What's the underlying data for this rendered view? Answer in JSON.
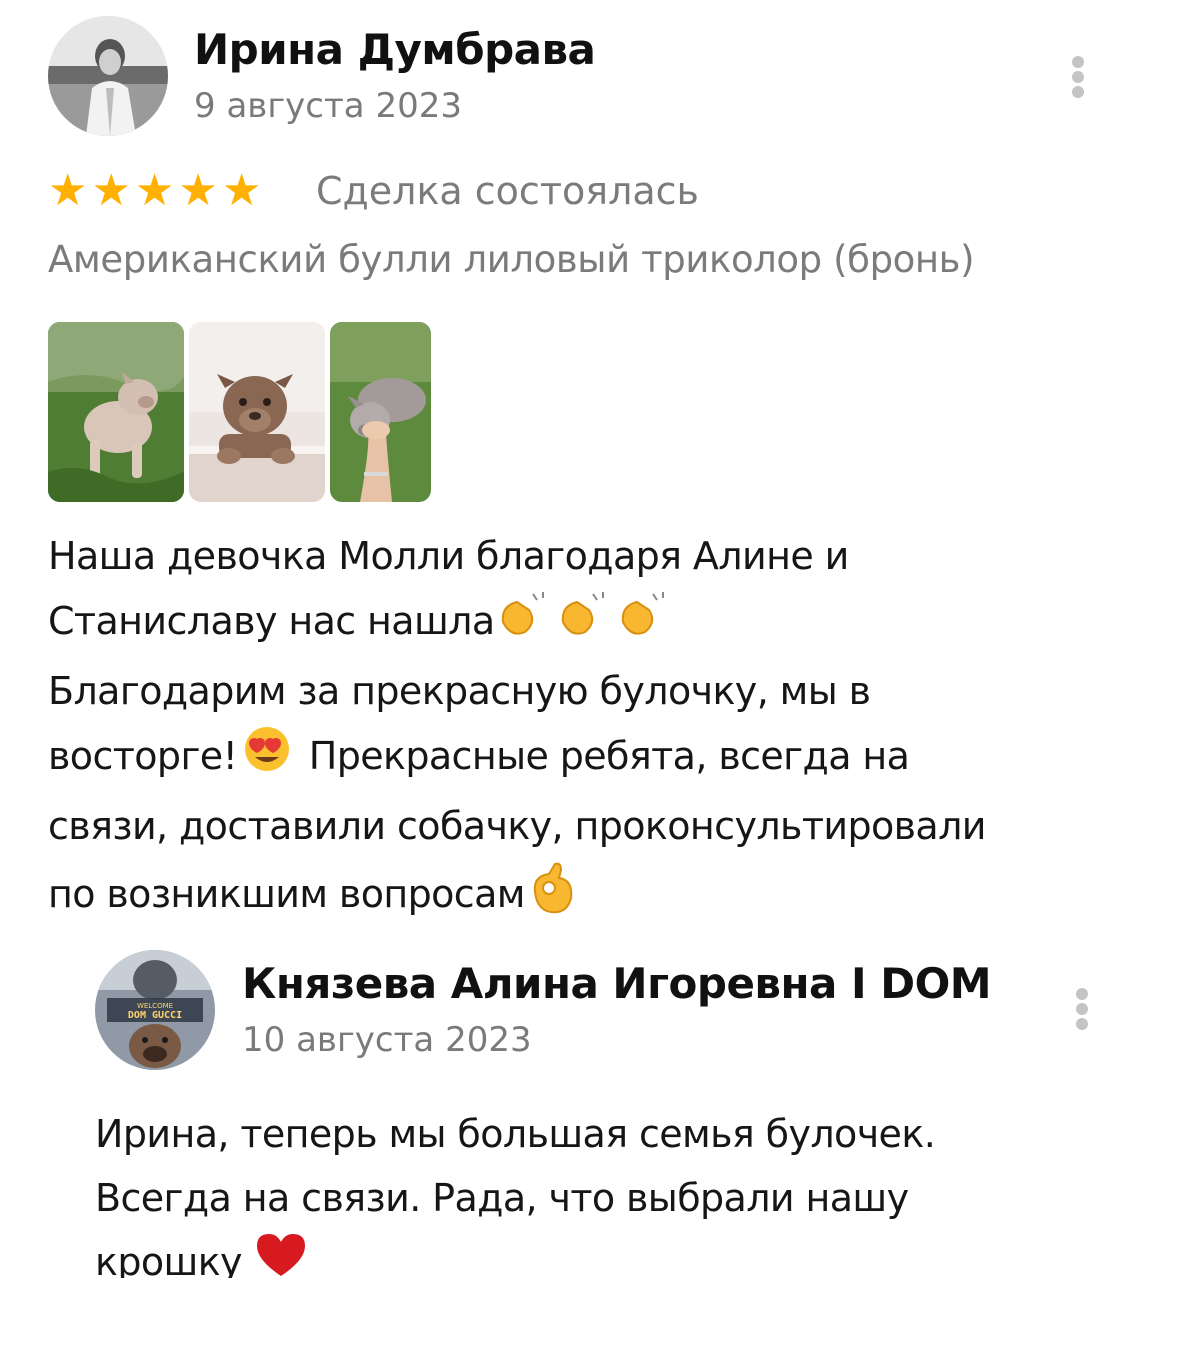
{
  "review": {
    "author": "Ирина Думбрава",
    "date": "9 августа 2023",
    "rating": 5,
    "star_color": "#ffb000",
    "status": "Сделка состоялась",
    "product": "Американский булли лиловый триколор (бронь)",
    "photos": [
      "puppy-grass-photo",
      "puppy-bath-photo",
      "puppy-hand-photo"
    ],
    "text_lines": [
      "Наша девочка Молли благодаря Алине и",
      "Станиславу нас нашла",
      "Благодарим за прекрасную булочку, мы в",
      "восторге!",
      " Прекрасные ребята, всегда на",
      "связи, доставили собачку, проконсультировали",
      "по возникшим вопросам"
    ]
  },
  "reply": {
    "author": "Князева Алина Игоревна I DOM",
    "date": "10 августа 2023",
    "avatar_text": "WELCOME DOM GUCCI",
    "text_lines": [
      "Ирина, теперь мы большая семья булочек.",
      "Всегда на связи. Рада, что выбрали нашу",
      "крошку"
    ]
  }
}
